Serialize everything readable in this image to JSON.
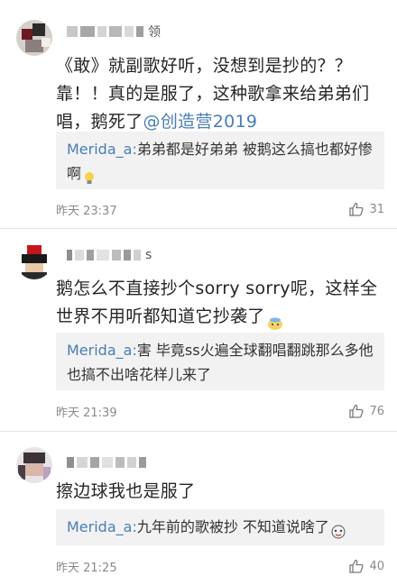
{
  "comments": [
    {
      "username_tail": "领",
      "body_line1": "《敢》就副歌好听，没想到是抄的？？",
      "body_line2": "靠！！真的是服了，这种歌拿来给弟弟们",
      "body_line3_prefix": "唱，鹅死了",
      "body_mention": "@创造营2019",
      "reply_name": "Merida_a:",
      "reply_text": "弟弟都是好弟弟 被鹅这么搞也都好惨啊",
      "time": "昨天 23:37",
      "likes": "31"
    },
    {
      "username_tail": "s",
      "body_line1": "鹅怎么不直接抄个sorry sorry呢，这样全",
      "body_line2": "世界不用听都知道它抄袭了",
      "reply_name": "Merida_a:",
      "reply_text": "害 毕竟ss火遍全球翻唱翻跳那么多他也搞不出啥花样儿来了",
      "time": "昨天 21:39",
      "likes": "76"
    },
    {
      "username_tail": "",
      "body_line1": "擦边球我也是服了",
      "reply_name": "Merida_a:",
      "reply_text": "九年前的歌被抄 不知道说啥了",
      "time": "昨天 21:25",
      "likes": "40"
    }
  ]
}
